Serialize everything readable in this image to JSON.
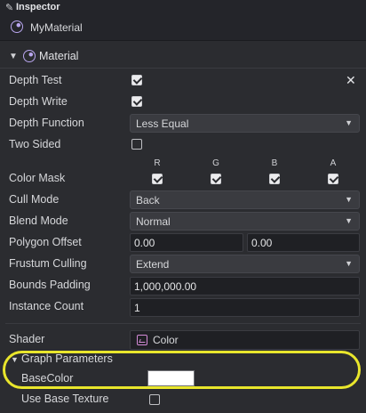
{
  "panel": {
    "tab_title": "Inspector",
    "asset_name": "MyMaterial",
    "close": "✕"
  },
  "section": {
    "title": "Material"
  },
  "rows": {
    "depth_test": {
      "label": "Depth Test",
      "checked": true
    },
    "depth_write": {
      "label": "Depth Write",
      "checked": true
    },
    "depth_function": {
      "label": "Depth Function",
      "value": "Less Equal"
    },
    "two_sided": {
      "label": "Two Sided",
      "checked": false
    },
    "color_mask": {
      "label": "Color Mask",
      "channels": [
        "R",
        "G",
        "B",
        "A"
      ]
    },
    "cull_mode": {
      "label": "Cull Mode",
      "value": "Back"
    },
    "blend_mode": {
      "label": "Blend Mode",
      "value": "Normal"
    },
    "polygon_offset": {
      "label": "Polygon Offset",
      "factor": "0.00",
      "units": "0.00"
    },
    "frustum_culling": {
      "label": "Frustum Culling",
      "value": "Extend"
    },
    "bounds_padding": {
      "label": "Bounds Padding",
      "value": "1,000,000.00"
    },
    "instance_count": {
      "label": "Instance Count",
      "value": "1"
    }
  },
  "shader": {
    "label": "Shader",
    "value": "Color"
  },
  "graph_parameters": {
    "title": "Graph Parameters",
    "base_color": {
      "label": "BaseColor",
      "color": "#ffffff"
    },
    "use_base_texture": {
      "label": "Use Base Texture",
      "checked": false
    }
  },
  "colors": {
    "accent": "#b9a6ef",
    "highlight": "#e9e62c",
    "background": "#2b2c30"
  }
}
